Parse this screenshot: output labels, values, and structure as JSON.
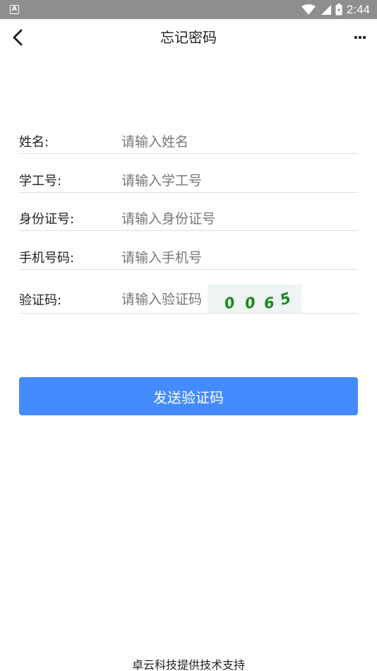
{
  "status_bar": {
    "time": "2:44"
  },
  "header": {
    "title": "忘记密码"
  },
  "form": {
    "name": {
      "label": "姓名:",
      "placeholder": "请输入姓名"
    },
    "student_id": {
      "label": "学工号:",
      "placeholder": "请输入学工号"
    },
    "id_card": {
      "label": "身份证号:",
      "placeholder": "请输入身份证号"
    },
    "phone": {
      "label": "手机号码:",
      "placeholder": "请输入手机号"
    },
    "captcha": {
      "label": "验证码:",
      "placeholder": "请输入验证码",
      "captcha_text": "0065"
    }
  },
  "send_button_label": "发送验证码",
  "footer": "卓云科技提供技术支持",
  "colors": {
    "primary": "#448bff",
    "status_bar": "#8e8e8e",
    "captcha_text": "#1a8a1a"
  }
}
